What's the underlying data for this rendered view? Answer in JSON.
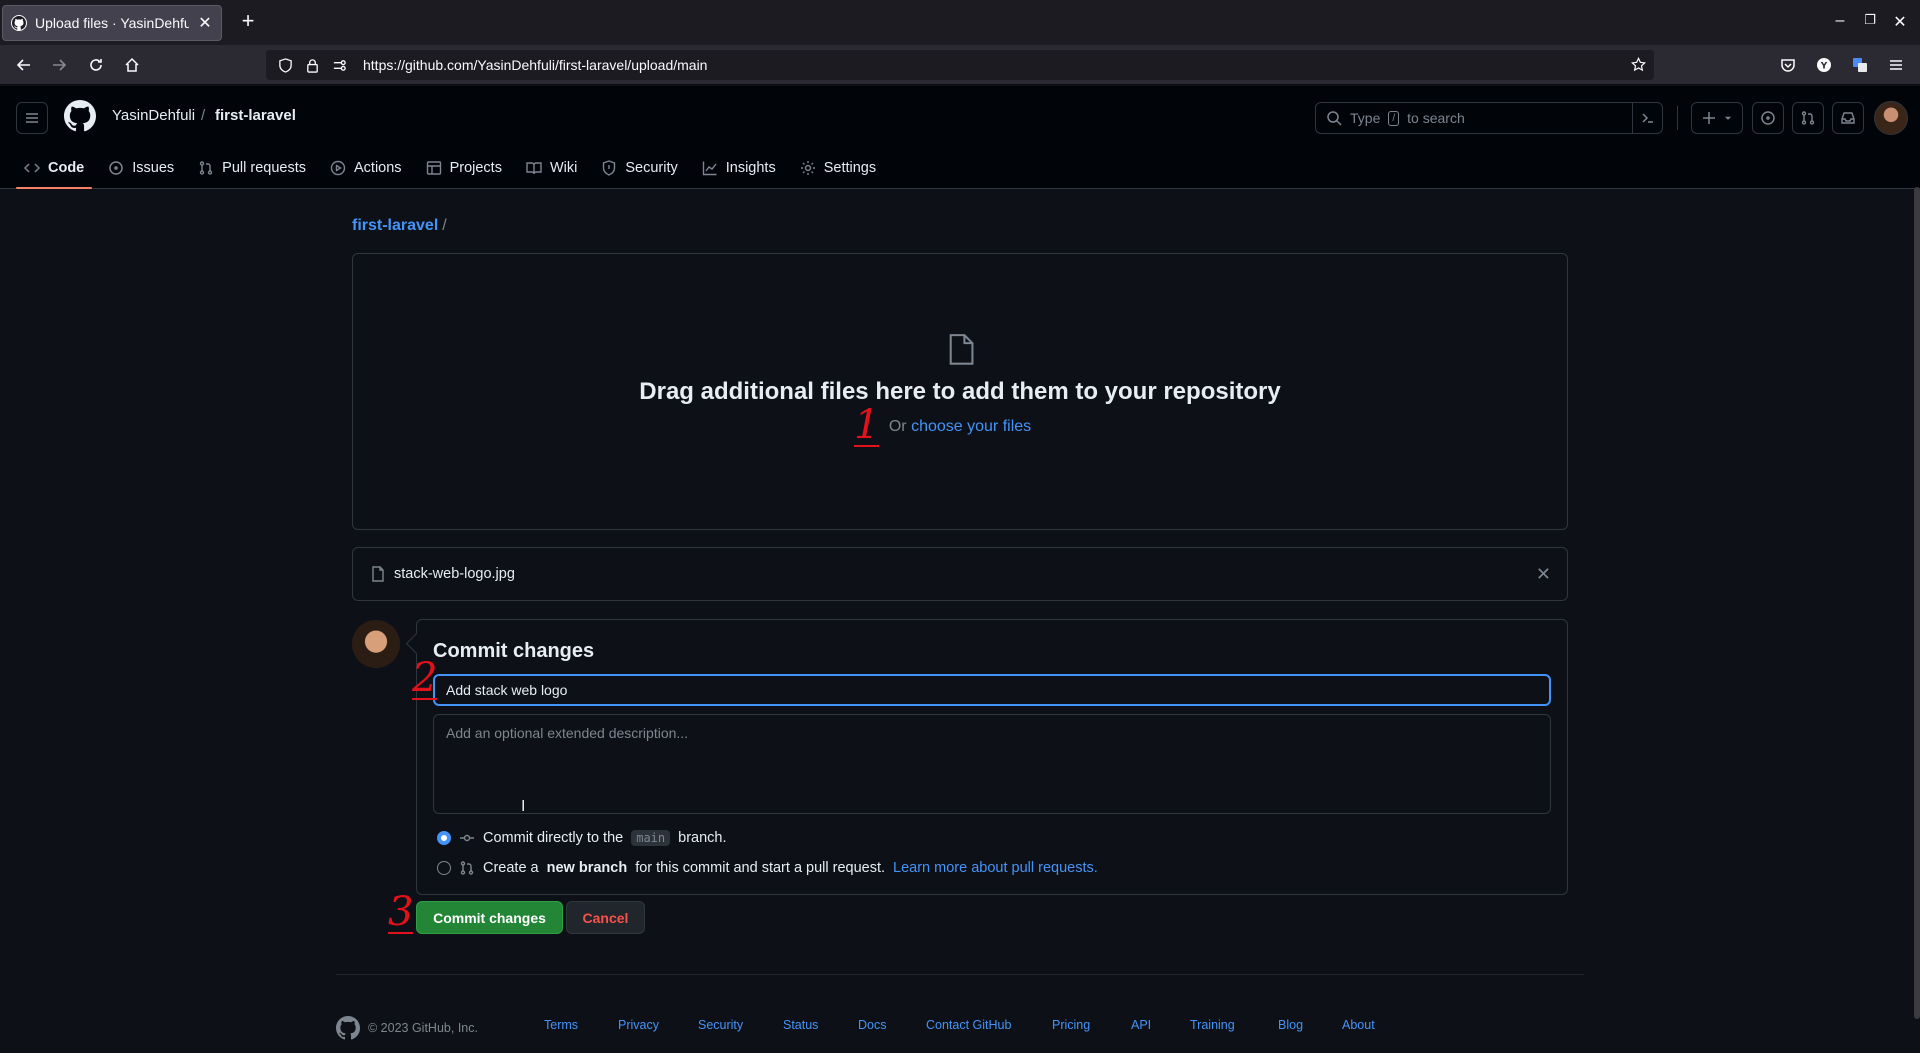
{
  "browser": {
    "tab_title": "Upload files · YasinDehfuli/fi",
    "url": "https://github.com/YasinDehfuli/first-laravel/upload/main"
  },
  "header": {
    "owner": "YasinDehfuli",
    "separator": "/",
    "repo": "first-laravel",
    "search_prefix": "Type",
    "search_key": "/",
    "search_suffix": "to search"
  },
  "repo_nav": {
    "items": [
      {
        "label": "Code",
        "icon": "code-icon"
      },
      {
        "label": "Issues",
        "icon": "issue-icon"
      },
      {
        "label": "Pull requests",
        "icon": "pull-request-icon"
      },
      {
        "label": "Actions",
        "icon": "play-icon"
      },
      {
        "label": "Projects",
        "icon": "table-icon"
      },
      {
        "label": "Wiki",
        "icon": "book-icon"
      },
      {
        "label": "Security",
        "icon": "shield-icon"
      },
      {
        "label": "Insights",
        "icon": "graph-icon"
      },
      {
        "label": "Settings",
        "icon": "gear-icon"
      }
    ]
  },
  "breadcrumb": {
    "repo": "first-laravel",
    "sep": "/"
  },
  "dropzone": {
    "title": "Drag additional files here to add them to your repository",
    "or_text": "Or",
    "choose_link": "choose your files"
  },
  "file": {
    "name": "stack-web-logo.jpg"
  },
  "commit": {
    "title": "Commit changes",
    "message_value": "Add stack web logo",
    "description_placeholder": "Add an optional extended description...",
    "option1_prefix": "Commit directly to the",
    "option1_branch": "main",
    "option1_suffix": "branch.",
    "option2_prefix": "Create a",
    "option2_bold": "new branch",
    "option2_suffix": "for this commit and start a pull request.",
    "option2_link": "Learn more about pull requests.",
    "commit_button": "Commit changes",
    "cancel_button": "Cancel"
  },
  "annotations": {
    "a1": "1",
    "a2": "2",
    "a3": "3"
  },
  "footer": {
    "copyright": "© 2023 GitHub, Inc.",
    "links": [
      "Terms",
      "Privacy",
      "Security",
      "Status",
      "Docs",
      "Contact GitHub",
      "Pricing",
      "API",
      "Training",
      "Blog",
      "About"
    ]
  },
  "colors": {
    "accent": "#4493f8",
    "primary_button": "#238636",
    "danger": "#f85149",
    "annotation": "#e3111b",
    "background": "#0d1117"
  }
}
